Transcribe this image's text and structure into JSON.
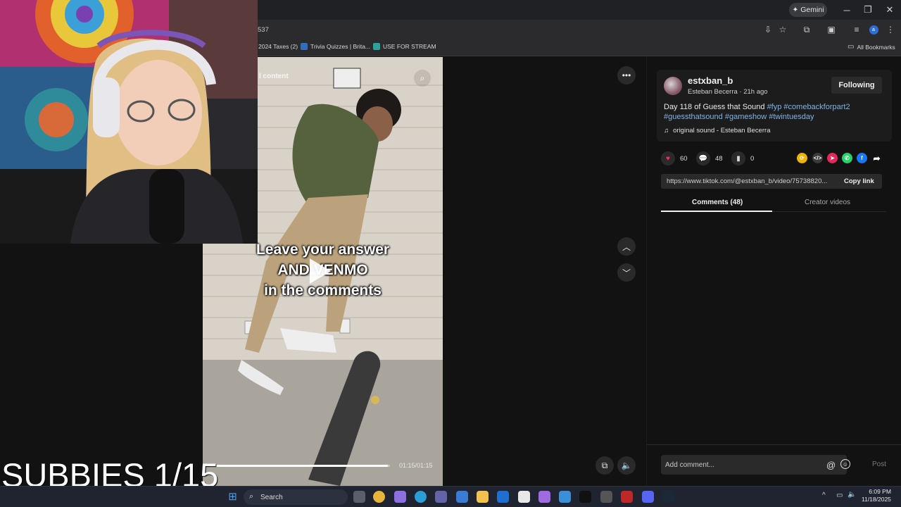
{
  "browser": {
    "gemini_label": "Gemini",
    "gemini_icon": "sparkle-icon",
    "url_fragment": "537",
    "bookmarks": [
      {
        "label": "2024 Taxes (2)",
        "color": "#4b5360"
      },
      {
        "label": "Trivia Quizzes | Brita...",
        "color": "#2f6fbf"
      },
      {
        "label": "USE FOR STREAM",
        "color": "#2aa39a"
      }
    ],
    "all_bookmarks_label": "All Bookmarks"
  },
  "video": {
    "mature_label": "l content",
    "caption_lines": [
      "Leave your answer",
      "AND VENMO",
      "in the comments"
    ],
    "time_readout": "01:15/01:15",
    "progress": 0.99
  },
  "post": {
    "username": "estxban_b",
    "subtitle": "Esteban Becerra · 21h ago",
    "follow_label": "Following",
    "desc_text": "Day 118 of Guess that Sound ",
    "hashtags": [
      "#fyp",
      "#comebackforpart2",
      "#guessthatsound",
      "#gameshow",
      "#twintuesday"
    ],
    "sound": "original sound - Esteban Becerra",
    "likes": "60",
    "comments": "48",
    "saves": "0",
    "link": "https://www.tiktok.com/@estxban_b/video/75738820...",
    "copy_link_label": "Copy link",
    "tab_comments": "Comments (48)",
    "tab_creator": "Creator videos",
    "comment_placeholder": "Add comment...",
    "post_label": "Post",
    "share_colors": [
      "#f0b400",
      "#3a3a3a",
      "#e5285a",
      "#25d366",
      "#1877f2"
    ]
  },
  "overlay": {
    "subbies_text": "SUBBIES 1/15"
  },
  "taskbar": {
    "search_label": "Search",
    "time": "6:09 PM",
    "date": "11/18/2025"
  }
}
